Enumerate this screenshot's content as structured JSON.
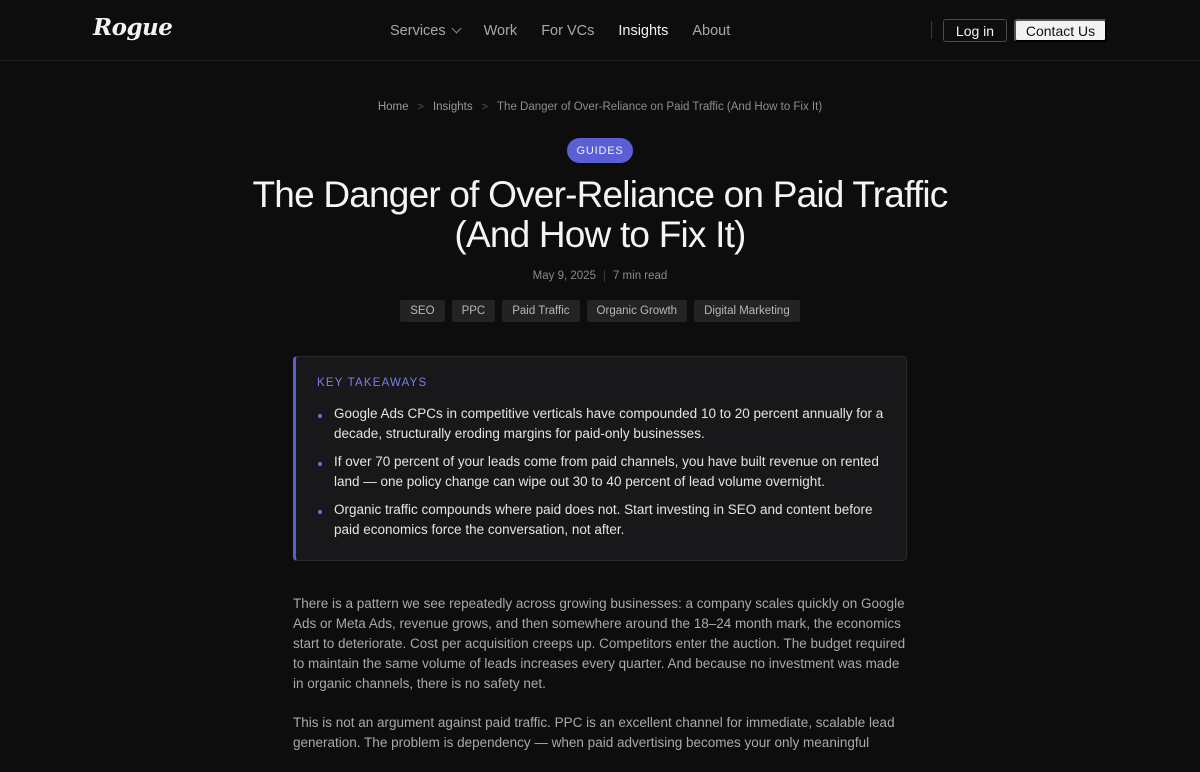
{
  "header": {
    "logo": "Rogue",
    "nav": [
      {
        "label": "Services",
        "has_dropdown": true,
        "active": false
      },
      {
        "label": "Work",
        "has_dropdown": false,
        "active": false
      },
      {
        "label": "For VCs",
        "has_dropdown": false,
        "active": false
      },
      {
        "label": "Insights",
        "has_dropdown": false,
        "active": true
      },
      {
        "label": "About",
        "has_dropdown": false,
        "active": false
      }
    ],
    "login_label": "Log in",
    "contact_label": "Contact Us"
  },
  "breadcrumb": {
    "items": [
      "Home",
      "Insights",
      "The Danger of Over-Reliance on Paid Traffic (And How to Fix It)"
    ],
    "separator": ">"
  },
  "article": {
    "category": "GUIDES",
    "title": "The Danger of Over-Reliance on Paid Traffic (And How to Fix It)",
    "date": "May 9, 2025",
    "read_time": "7 min read",
    "tags": [
      "SEO",
      "PPC",
      "Paid Traffic",
      "Organic Growth",
      "Digital Marketing"
    ],
    "takeaways": {
      "title": "KEY TAKEAWAYS",
      "items": [
        "Google Ads CPCs in competitive verticals have compounded 10 to 20 percent annually for a decade, structurally eroding margins for paid-only businesses.",
        "If over 70 percent of your leads come from paid channels, you have built revenue on rented land — one policy change can wipe out 30 to 40 percent of lead volume overnight.",
        "Organic traffic compounds where paid does not. Start investing in SEO and content before paid economics force the conversation, not after."
      ]
    },
    "paragraphs": [
      "There is a pattern we see repeatedly across growing businesses: a company scales quickly on Google Ads or Meta Ads, revenue grows, and then somewhere around the 18–24 month mark, the economics start to deteriorate. Cost per acquisition creeps up. Competitors enter the auction. The budget required to maintain the same volume of leads increases every quarter. And because no investment was made in organic channels, there is no safety net.",
      "This is not an argument against paid traffic. PPC is an excellent channel for immediate, scalable lead generation. The problem is dependency — when paid advertising becomes your only meaningful"
    ]
  },
  "colors": {
    "background": "#0d0d0d",
    "accent": "#5b5fd4",
    "card": "#18181a"
  }
}
